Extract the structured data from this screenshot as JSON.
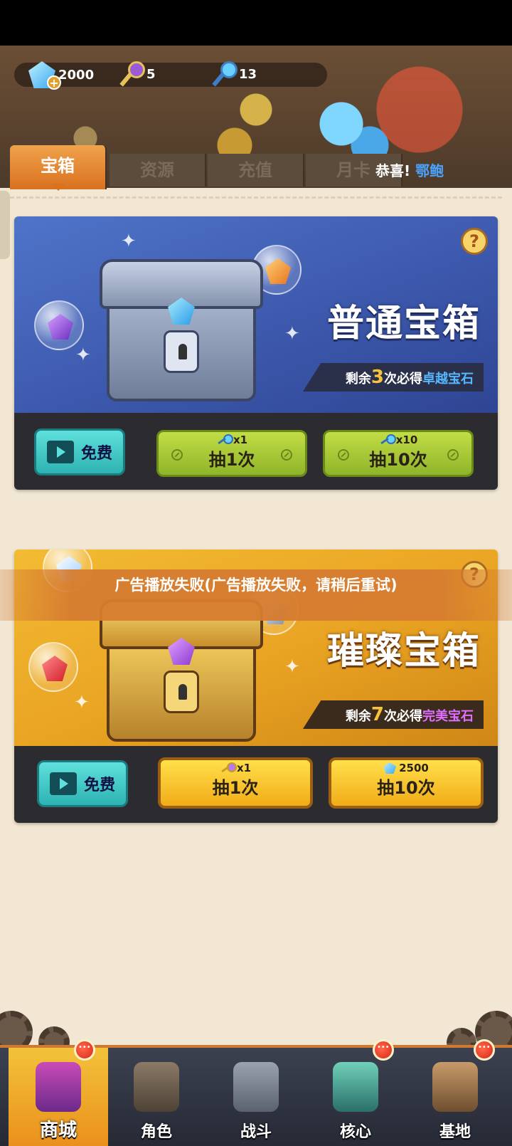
{
  "resources": {
    "diamonds": "2000",
    "purple_keys": "5",
    "blue_keys": "13"
  },
  "tabs": [
    {
      "label": "宝箱",
      "active": true
    },
    {
      "label": "资源",
      "active": false
    },
    {
      "label": "充值",
      "active": false
    },
    {
      "label": "月卡",
      "active": false
    }
  ],
  "marquee": {
    "prefix": "恭喜!",
    "name": "鄂鲍"
  },
  "chests": [
    {
      "title": "普通宝箱",
      "remain_prefix": "剩余",
      "remain_count": "3",
      "remain_mid": "次必得",
      "remain_reward": "卓越宝石",
      "free_label": "免费",
      "draw1": {
        "cost": "x1",
        "label": "抽1次"
      },
      "draw10": {
        "cost": "x10",
        "label": "抽10次"
      },
      "help": "?"
    },
    {
      "title": "璀璨宝箱",
      "remain_prefix": "剩余",
      "remain_count": "7",
      "remain_mid": "次必得",
      "remain_reward": "完美宝石",
      "free_label": "免费",
      "draw1": {
        "cost": "x1",
        "label": "抽1次"
      },
      "draw10": {
        "cost": "2500",
        "label": "抽10次"
      },
      "help": "?"
    }
  ],
  "toast": "广告播放失败(广告播放失败，请稍后重试)",
  "nav": [
    {
      "label": "商城",
      "active": true,
      "badge": true
    },
    {
      "label": "角色",
      "active": false,
      "badge": false
    },
    {
      "label": "战斗",
      "active": false,
      "badge": false
    },
    {
      "label": "核心",
      "active": false,
      "badge": true
    },
    {
      "label": "基地",
      "active": false,
      "badge": true
    }
  ],
  "colors": {
    "background": "#f1e7d2",
    "tab_active": "#e28a2c",
    "common_chest": "#4565b8",
    "brilliant_chest": "#eaa526",
    "free_button": "#3cc7c4",
    "green_button": "#a6c836",
    "yellow_button": "#f7c52c",
    "toast": "#d67c30",
    "nav": "#30343f"
  }
}
